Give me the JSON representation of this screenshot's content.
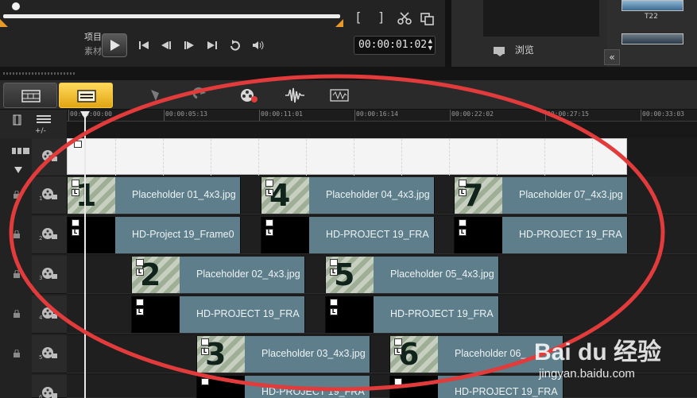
{
  "player": {
    "mode_project": "项目",
    "mode_clip": "素材",
    "timecode": "00:00:01:02",
    "mark_in": "[",
    "mark_out": "]"
  },
  "library": {
    "browse_label": "浏览",
    "thumb_label": "T22",
    "collapse_glyph": "«"
  },
  "ruler": {
    "ticks": [
      "00:00:00:00",
      "00:00:05:13",
      "00:00:11:01",
      "00:00:16:14",
      "00:00:22:02",
      "00:00:27:15",
      "00:00:33:03"
    ]
  },
  "tracks": {
    "add_remove": "+/-",
    "rows": [
      {
        "number": "1"
      },
      {
        "number": "2"
      },
      {
        "number": "3"
      },
      {
        "number": "4"
      },
      {
        "number": "5"
      },
      {
        "number": "6"
      }
    ],
    "clips": {
      "c1": {
        "digit": "1",
        "name": "Placeholder 01_4x3.jpg"
      },
      "c4": {
        "digit": "4",
        "name": "Placeholder 04_4x3.jpg"
      },
      "c7": {
        "digit": "7",
        "name": "Placeholder 07_4x3.jpg"
      },
      "f1": {
        "name": "HD-Project 19_Frame0"
      },
      "f4": {
        "name": "HD-PROJECT 19_FRA"
      },
      "f7": {
        "name": "HD-PROJECT 19_FRA"
      },
      "c2": {
        "digit": "2",
        "name": "Placeholder 02_4x3.jpg"
      },
      "c5": {
        "digit": "5",
        "name": "Placeholder 05_4x3.jpg"
      },
      "f2": {
        "name": "HD-PROJECT 19_FRA"
      },
      "f5": {
        "name": "HD-PROJECT 19_FRA"
      },
      "c3": {
        "digit": "3",
        "name": "Placeholder 03_4x3.jpg"
      },
      "c6": {
        "digit": "6",
        "name": "Placeholder 06_"
      },
      "f3": {
        "name": "HD-PROJECT 19_FRA"
      },
      "f6": {
        "name": "HD-PROJECT 19_FRA"
      }
    }
  },
  "watermark": {
    "brand": "Bai du 经验",
    "url": "jingyan.baidu.com"
  },
  "colors": {
    "accent": "#e2a513",
    "annotation_red": "#e23b3b",
    "clip": "#5d7e8a"
  }
}
